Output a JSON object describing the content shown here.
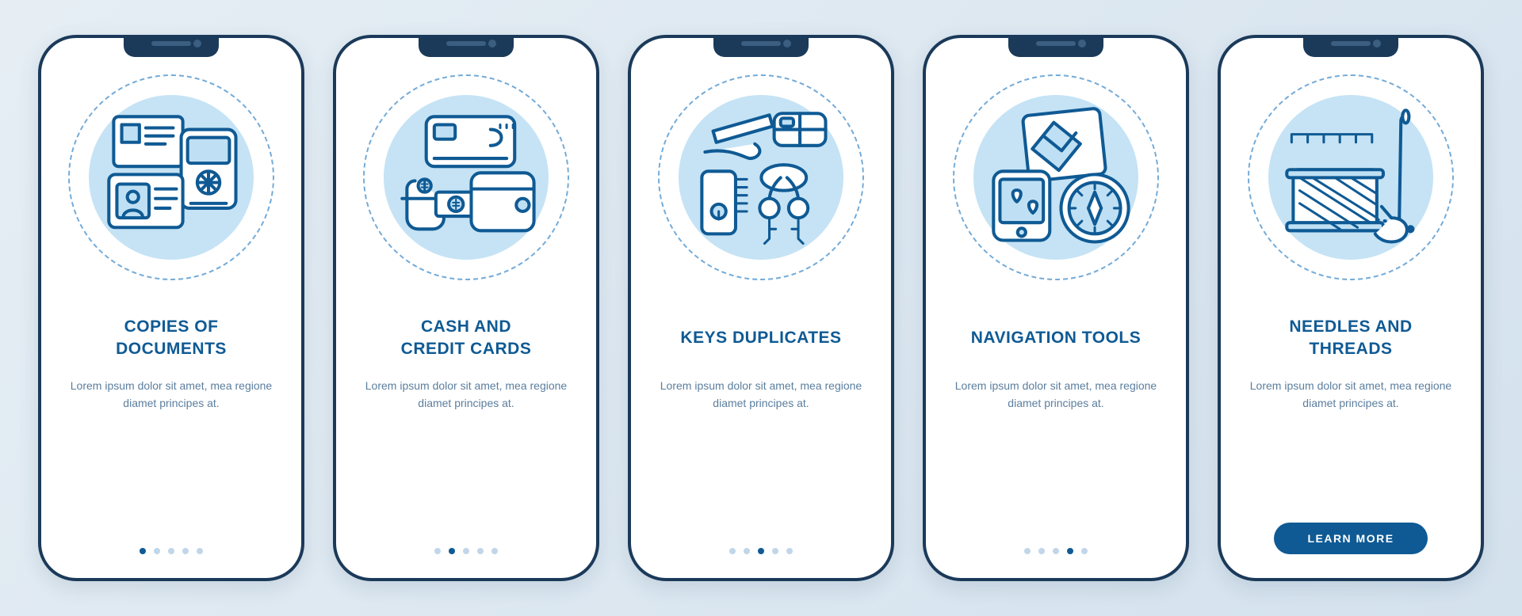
{
  "cards": [
    {
      "title": "COPIES OF\nDOCUMENTS",
      "desc": "Lorem ipsum dolor sit amet, mea regione diamet principes at.",
      "icon": "docs",
      "active": 0
    },
    {
      "title": "CASH AND\nCREDIT CARDS",
      "desc": "Lorem ipsum dolor sit amet, mea regione diamet principes at.",
      "icon": "cash",
      "active": 1
    },
    {
      "title": "KEYS DUPLICATES",
      "desc": "Lorem ipsum dolor sit amet, mea regione diamet principes at.",
      "icon": "keys",
      "active": 2
    },
    {
      "title": "NAVIGATION TOOLS",
      "desc": "Lorem ipsum dolor sit amet, mea regione diamet principes at.",
      "icon": "nav",
      "active": 3
    },
    {
      "title": "NEEDLES AND\nTHREADS",
      "desc": "Lorem ipsum dolor sit amet, mea regione diamet principes at.",
      "icon": "sew",
      "active": 4
    }
  ],
  "cta_label": "LEARN MORE",
  "total_dots": 5
}
